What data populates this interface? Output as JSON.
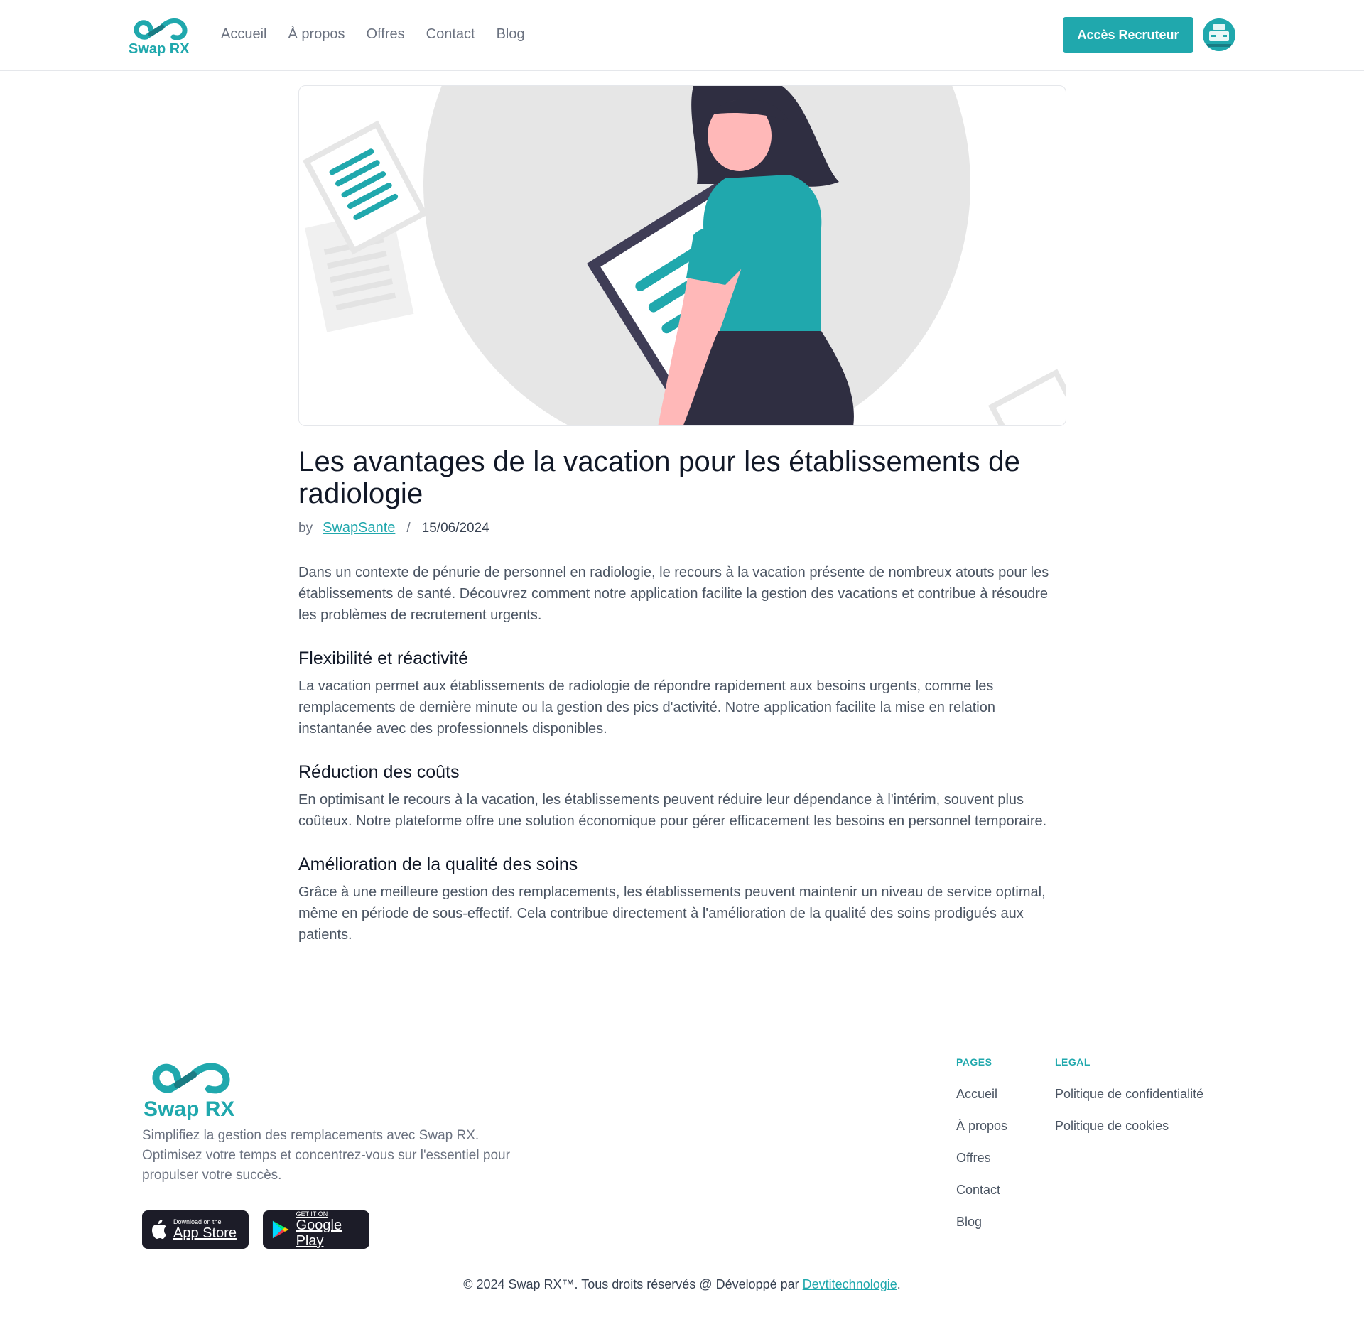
{
  "brand": {
    "name": "Swap RX",
    "accent": "#20a8ad",
    "dark": "#2f2e41"
  },
  "header": {
    "nav": [
      "Accueil",
      "À propos",
      "Offres",
      "Contact",
      "Blog"
    ],
    "recruiter_button": "Accès Recruteur"
  },
  "article": {
    "title": "Les avantages de la vacation pour les établissements de radiologie",
    "by_label": "by",
    "author": "SwapSante",
    "separator": "/",
    "date": "15/06/2024",
    "intro": "Dans un contexte de pénurie de personnel en radiologie, le recours à la vacation présente de nombreux atouts pour les établissements de santé. Découvrez comment notre application facilite la gestion des vacations et contribue à résoudre les problèmes de recrutement urgents.",
    "sections": [
      {
        "heading": "Flexibilité et réactivité",
        "text": "La vacation permet aux établissements de radiologie de répondre rapidement aux besoins urgents, comme les remplacements de dernière minute ou la gestion des pics d'activité. Notre application facilite la mise en relation instantanée avec des professionnels disponibles."
      },
      {
        "heading": "Réduction des coûts",
        "text": "En optimisant le recours à la vacation, les établissements peuvent réduire leur dépendance à l'intérim, souvent plus coûteux. Notre plateforme offre une solution économique pour gérer efficacement les besoins en personnel temporaire."
      },
      {
        "heading": "Amélioration de la qualité des soins",
        "text": "Grâce à une meilleure gestion des remplacements, les établissements peuvent maintenir un niveau de service optimal, même en période de sous-effectif. Cela contribue directement à l'amélioration de la qualité des soins prodigués aux patients."
      }
    ]
  },
  "footer": {
    "tagline": "Simplifiez la gestion des remplacements avec Swap RX. Optimisez votre temps et concentrez-vous sur l'essentiel pour propulser votre succès.",
    "app_store": {
      "small": "Download on the",
      "big": "App Store"
    },
    "google_play": {
      "small": "GET IT ON",
      "big": "Google Play"
    },
    "pages_heading": "PAGES",
    "pages": [
      "Accueil",
      "À propos",
      "Offres",
      "Contact",
      "Blog"
    ],
    "legal_heading": "LEGAL",
    "legal": [
      "Politique de confidentialité",
      "Politique de cookies"
    ],
    "copyright_text": "© 2024 Swap RX™. Tous droits réservés @ Développé par ",
    "developer": "Devtitechnologie",
    "copyright_end": "."
  }
}
